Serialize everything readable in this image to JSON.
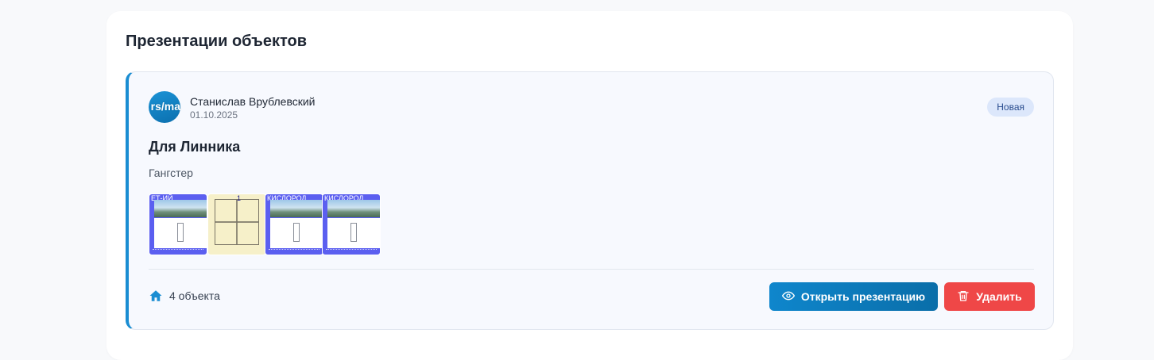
{
  "panel": {
    "title": "Презентации объектов"
  },
  "card": {
    "avatar_text": "rs/ma",
    "author": "Станислав Врублевский",
    "date": "01.10.2025",
    "badge": "Новая",
    "title": "Для Линника",
    "description": "Гангстер",
    "thumbnails": [
      {
        "kind": "brochure",
        "header": "ЕТ-ИЙ"
      },
      {
        "kind": "floorplan",
        "header": "1"
      },
      {
        "kind": "brochure",
        "header": "КИСЛОРОД"
      },
      {
        "kind": "brochure",
        "header": "КИСЛОРОД"
      }
    ],
    "objects_count": "4 объекта",
    "open_button": "Открыть презентацию",
    "delete_button": "Удалить"
  },
  "icons": {
    "objects": "home-icon",
    "open": "eye-icon",
    "delete": "trash-icon"
  },
  "colors": {
    "accent": "#1a8dd2",
    "danger": "#ef4747",
    "badge_bg": "#dce7fb",
    "thumb_blue": "#5b5ff0"
  }
}
